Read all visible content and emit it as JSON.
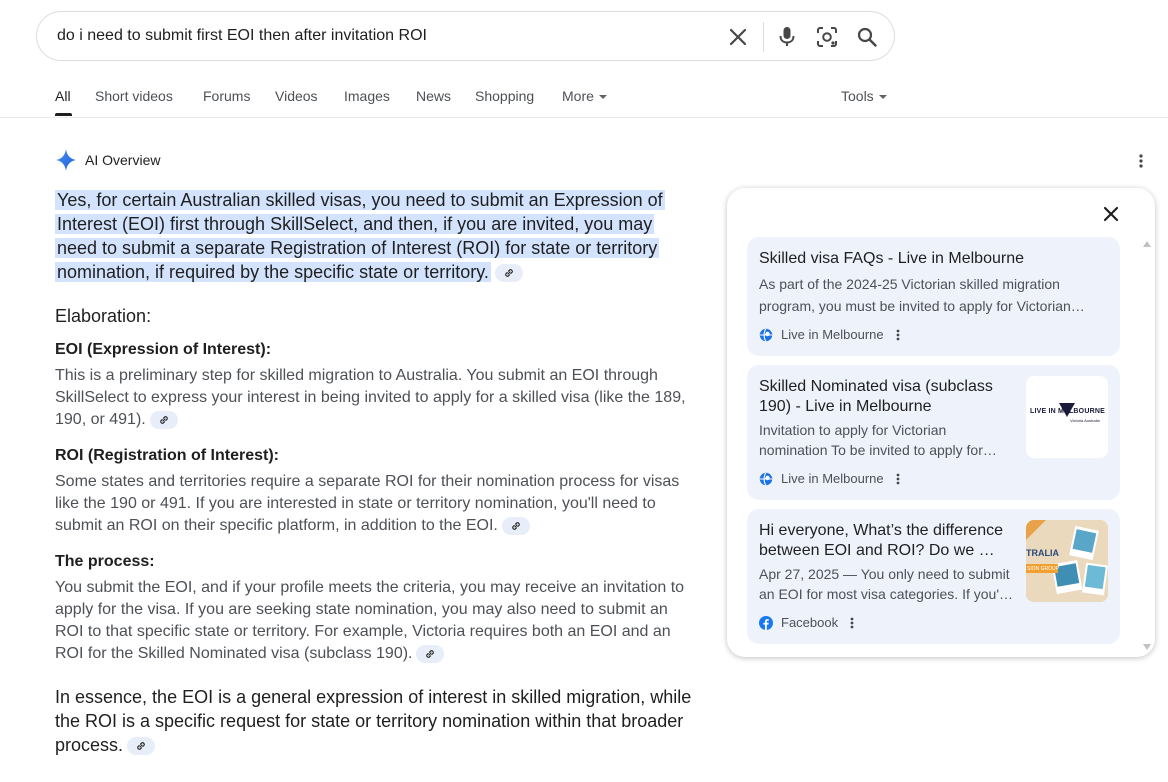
{
  "search": {
    "query": "do i need to submit first EOI then after invitation ROI"
  },
  "tabs": [
    {
      "label": "All"
    },
    {
      "label": "Short videos"
    },
    {
      "label": "Forums"
    },
    {
      "label": "Videos"
    },
    {
      "label": "Images"
    },
    {
      "label": "News"
    },
    {
      "label": "Shopping"
    },
    {
      "label": "More"
    }
  ],
  "tools_label": "Tools",
  "ai_overview": {
    "title": "AI Overview",
    "lead": "Yes, for certain Australian skilled visas, you need to submit an Expression of Interest (EOI) first through SkillSelect, and then, if you are invited, you may need to submit a separate Registration of Interest (ROI) for state or territory nomination, if required by the specific state or territory.",
    "section_title": "Elaboration:",
    "sections": [
      {
        "title": "EOI (Expression of Interest):",
        "text": "This is a preliminary step for skilled migration to Australia. You submit an EOI through SkillSelect to express your interest in being invited to apply for a skilled visa (like the 189, 190, or 491)."
      },
      {
        "title": "ROI (Registration of Interest):",
        "text": "Some states and territories require a separate ROI for their nomination process for visas like the 190 or 491. If you are interested in state or territory nomination, you'll need to submit an ROI on their specific platform, in addition to the EOI."
      },
      {
        "title": "The process:",
        "text": "You submit the EOI, and if your profile meets the criteria, you may receive an invitation to apply for the visa. If you are seeking state nomination, you may also need to submit an ROI to that specific state or territory. For example, Victoria requires both an EOI and an ROI for the Skilled Nominated visa (subclass 190)."
      }
    ],
    "summary": "In essence, the EOI is a general expression of interest in skilled migration, while the ROI is a specific request for state or territory nomination within that broader process."
  },
  "sources": [
    {
      "title": "Skilled visa FAQs - Live in Melbourne",
      "snippet_1": "As part of the 2024-25 Victorian skilled migration",
      "snippet_2": "program, you must be invited to apply for Victorian…",
      "source": "Live in Melbourne"
    },
    {
      "title_1": "Skilled Nominated visa (subclass",
      "title_2": "190) - Live in Melbourne",
      "snippet_1": "Invitation to apply for Victorian",
      "snippet_2": "nomination To be invited to apply for…",
      "source": "Live in Melbourne",
      "thumb_text_1": "LIVE IN MELBOURNE",
      "thumb_text_2": "Victoria Australia"
    },
    {
      "title_1": "Hi everyone, What’s the difference",
      "title_2": "between EOI and ROI? Do we …",
      "snippet_1": "Apr 27, 2025 — You only need to submit",
      "snippet_2": "an EOI for most visa categories. If you'…",
      "source": "Facebook",
      "thumb_text_1": "TRALIA",
      "thumb_text_2": "SION GROUP"
    }
  ],
  "colors": {
    "accent_blue": "#1a73e8",
    "highlight": "#d3e3fd",
    "card_bg": "#eef2fb",
    "facebook": "#1877f2"
  }
}
